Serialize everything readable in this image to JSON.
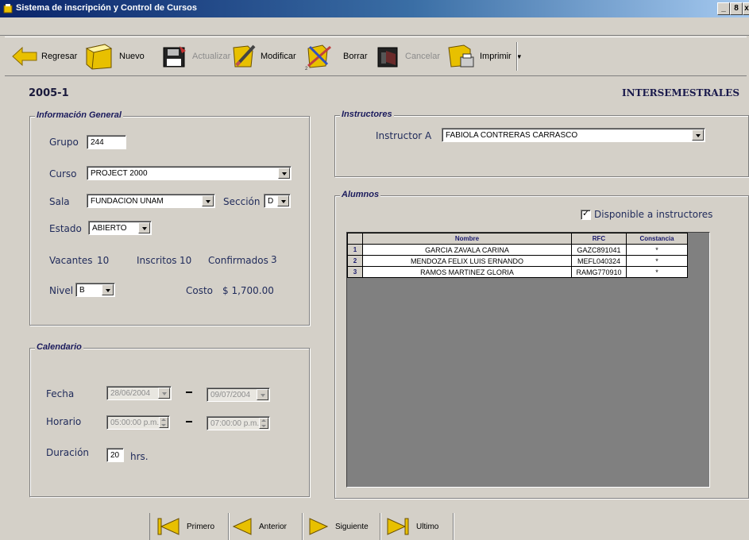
{
  "window": {
    "title": "Sistema de inscripción y Control de Cursos",
    "controls": [
      "_",
      "8",
      "x"
    ]
  },
  "toolbar": {
    "regresar": "Regresar",
    "nuevo": "Nuevo",
    "actualizar": "Actualizar",
    "modificar": "Modificar",
    "borrar": "Borrar",
    "cancelar": "Cancelar",
    "imprimir": "Imprimir"
  },
  "header": {
    "period": "2005-1",
    "type": "INTERSEMESTRALES"
  },
  "info": {
    "legend": "Información General",
    "grupo_label": "Grupo",
    "grupo_value": "244",
    "curso_label": "Curso",
    "curso_value": "PROJECT 2000",
    "sala_label": "Sala",
    "sala_value": "FUNDACION UNAM",
    "seccion_label": "Sección",
    "seccion_value": "D",
    "estado_label": "Estado",
    "estado_value": "ABIERTO",
    "vacantes_label": "Vacantes",
    "vacantes_value": "10",
    "inscritos_label": "Inscritos",
    "inscritos_value": "10",
    "confirmados_label": "Confirmados",
    "confirmados_value": "3",
    "nivel_label": "Nivel",
    "nivel_value": "B",
    "costo_label": "Costo",
    "costo_value": "$ 1,700.00"
  },
  "calendario": {
    "legend": "Calendario",
    "fecha_label": "Fecha",
    "fecha_inicio": "28/06/2004",
    "fecha_fin": "09/07/2004",
    "horario_label": "Horario",
    "hora_inicio": "05:00:00 p.m.",
    "hora_fin": "07:00:00 p.m.",
    "duracion_label": "Duración",
    "duracion_value": "20",
    "duracion_unit": "hrs."
  },
  "instructores": {
    "legend": "Instructores",
    "instructor_label": "Instructor A",
    "instructor_value": "FABIOLA CONTRERAS CARRASCO"
  },
  "alumnos": {
    "legend": "Alumnos",
    "disponible_label": "Disponible a instructores",
    "disponible_checked": true,
    "columns": [
      "Nombre",
      "RFC",
      "Constancia"
    ],
    "rows": [
      {
        "n": "1",
        "nombre": "GARCIA ZAVALA CARINA",
        "rfc": "GAZC891041",
        "constancia": "*"
      },
      {
        "n": "2",
        "nombre": "MENDOZA FELIX LUIS ERNANDO",
        "rfc": "MEFL040324",
        "constancia": "*"
      },
      {
        "n": "3",
        "nombre": "RAMOS MARTINEZ GLORIA",
        "rfc": "RAMG770910",
        "constancia": "*"
      }
    ]
  },
  "nav": {
    "primero": "Primero",
    "anterior": "Anterior",
    "siguiente": "Siguiente",
    "ultimo": "Ultimo"
  },
  "colors": {
    "accent_yellow": "#e8c000",
    "title_blue": "#0a246a",
    "label_blue": "#1f2a5a"
  }
}
